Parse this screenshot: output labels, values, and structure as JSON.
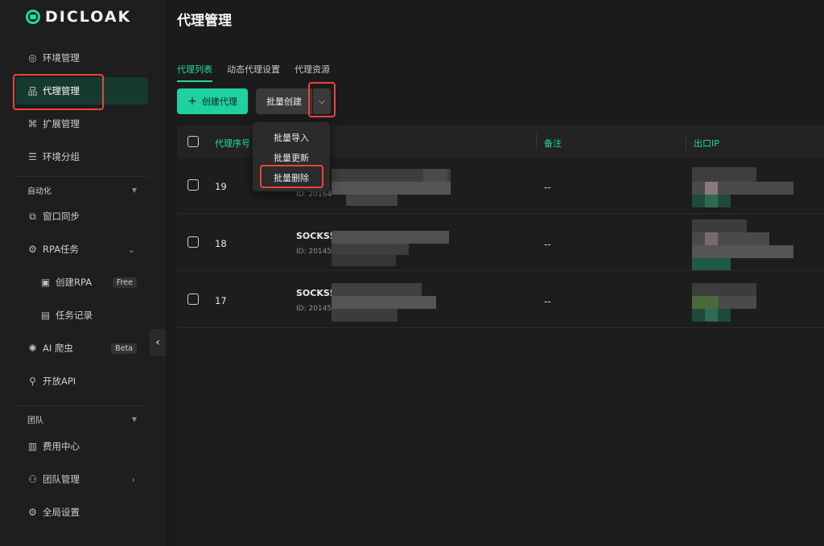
{
  "logo": {
    "text": "DICLOAK"
  },
  "sidebar": {
    "items": [
      {
        "label": "环境管理",
        "icon": "chrome-icon"
      },
      {
        "label": "代理管理",
        "icon": "proxy-icon"
      },
      {
        "label": "扩展管理",
        "icon": "extension-icon"
      },
      {
        "label": "环境分组",
        "icon": "group-icon"
      }
    ],
    "automation": {
      "title": "自动化",
      "items": [
        {
          "label": "窗口同步",
          "icon": "sync-window-icon"
        },
        {
          "label": "RPA任务",
          "icon": "robot-icon"
        },
        {
          "label": "创建RPA",
          "icon": "create-rpa-icon",
          "badge": "Free"
        },
        {
          "label": "任务记录",
          "icon": "task-record-icon"
        },
        {
          "label": "AI 爬虫",
          "icon": "bug-icon",
          "badge": "Beta"
        },
        {
          "label": "开放API",
          "icon": "api-icon"
        }
      ]
    },
    "team": {
      "title": "团队",
      "items": [
        {
          "label": "费用中心",
          "icon": "billing-icon"
        },
        {
          "label": "团队管理",
          "icon": "team-icon"
        },
        {
          "label": "全局设置",
          "icon": "settings-icon"
        }
      ]
    }
  },
  "main": {
    "title": "代理管理",
    "tabs": [
      "代理列表",
      "动态代理设置",
      "代理资源"
    ],
    "create_button": "创建代理",
    "batch_button": "批量创建",
    "dropdown": [
      "批量导入",
      "批量更新",
      "批量删除"
    ],
    "table": {
      "headers": {
        "seq": "代理序号",
        "note": "备注",
        "exit_ip": "出口IP"
      },
      "rows": [
        {
          "seq": "19",
          "name": "",
          "id": "ID: 20164",
          "note": "--"
        },
        {
          "seq": "18",
          "name": "SOCKS5",
          "id": "ID: 20145",
          "note": "--"
        },
        {
          "seq": "17",
          "name": "SOCKS5",
          "id": "ID: 20145",
          "note": "--"
        }
      ]
    }
  },
  "colors": {
    "accent": "#1fd8a4",
    "highlight": "#e8453c",
    "background": "#1b1b1b"
  }
}
